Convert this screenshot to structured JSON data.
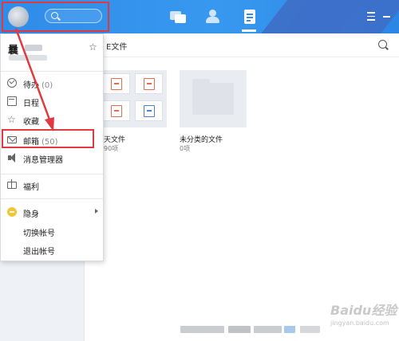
{
  "header": {
    "tabs": [
      {
        "icon": "message-icon"
      },
      {
        "icon": "contacts-icon"
      },
      {
        "icon": "file-icon",
        "active": true
      }
    ],
    "window_controls": [
      "menu-icon",
      "minimize-icon"
    ],
    "accent_color": "#2f8ce8"
  },
  "user": {
    "name": "曩",
    "signature": "柯子"
  },
  "menu": {
    "items": [
      {
        "id": "todo",
        "label": "待办",
        "count": "(0)",
        "icon": "todo-icon"
      },
      {
        "id": "calendar",
        "label": "日程",
        "icon": "calendar-icon"
      },
      {
        "id": "favorites",
        "label": "收藏",
        "icon": "star-icon"
      },
      {
        "id": "mailbox",
        "label": "邮箱",
        "count": "(50)",
        "icon": "mail-icon",
        "highlighted": true
      },
      {
        "id": "message-manager",
        "label": "消息管理器",
        "icon": "speaker-icon"
      },
      {
        "id": "benefits",
        "label": "福利",
        "icon": "gift-icon"
      },
      {
        "id": "status-hidden",
        "label": "隐身",
        "icon": "hidden-status-icon",
        "has_submenu": true
      },
      {
        "id": "switch-account",
        "label": "切换帐号"
      },
      {
        "id": "logout",
        "label": "退出帐号"
      }
    ]
  },
  "main": {
    "title": "E文件",
    "folders": [
      {
        "name": "天文件",
        "count": "90项"
      },
      {
        "name": "未分类的文件",
        "count": "0项"
      }
    ]
  },
  "watermark": {
    "logo": "Baidu经验",
    "url": "jingyan.baidu.com"
  },
  "annotation_color": "#e0393f"
}
